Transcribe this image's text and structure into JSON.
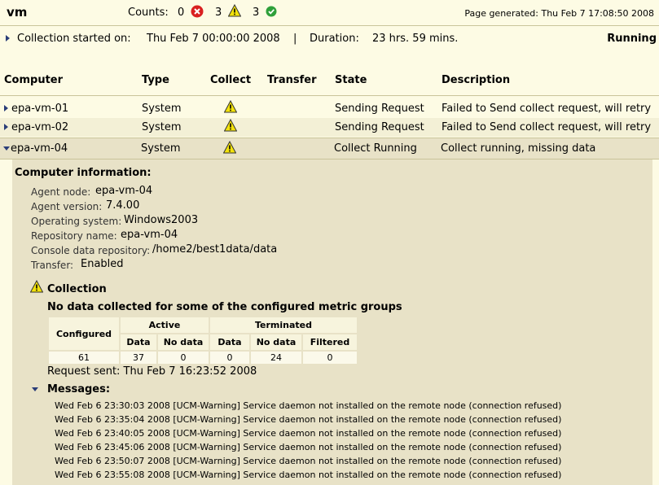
{
  "header": {
    "title": "vm",
    "counts_label": "Counts:",
    "error_count": "0",
    "warning_count": "3",
    "ok_count": "3",
    "page_generated": "Page generated: Thu Feb 7 17:08:50 2008"
  },
  "collection": {
    "started_label": "Collection started on:",
    "started_value": "Thu Feb 7 00:00:00 2008",
    "divider": "|",
    "duration_label": "Duration:",
    "duration_value": "23 hrs. 59 mins.",
    "status": "Running"
  },
  "columns": [
    "Computer",
    "Type",
    "Collect",
    "Transfer",
    "State",
    "Description"
  ],
  "rows": [
    {
      "computer": "epa-vm-01",
      "type": "System",
      "state": "Sending Request",
      "description": "Failed to Send collect request, will retry"
    },
    {
      "computer": "epa-vm-02",
      "type": "System",
      "state": "Sending Request",
      "description": "Failed to Send collect request, will retry"
    },
    {
      "computer": "epa-vm-04",
      "type": "System",
      "state": "Collect Running",
      "description": "Collect running, missing data"
    }
  ],
  "computer_info": {
    "heading": "Computer information:",
    "agent_node_label": "Agent node:",
    "agent_node": "epa-vm-04",
    "agent_version_label": "Agent version:",
    "agent_version": "7.4.00",
    "os_label": "Operating system:",
    "os": "Windows2003",
    "repo_label": "Repository name:",
    "repo": "epa-vm-04",
    "console_label": "Console data repository:",
    "console": "/home2/best1data/data",
    "transfer_label": "Transfer:",
    "transfer": "Enabled"
  },
  "collection_section": {
    "heading": "Collection",
    "note": "No data collected for some of the configured metric groups",
    "table": {
      "configured_label": "Configured",
      "active_label": "Active",
      "terminated_label": "Terminated",
      "data_label": "Data",
      "nodata_label": "No data",
      "filtered_label": "Filtered",
      "configured": "61",
      "active_data": "37",
      "active_nodata": "0",
      "term_data": "0",
      "term_nodata": "24",
      "term_filtered": "0"
    },
    "request_sent": "Request sent: Thu Feb 7 16:23:52 2008"
  },
  "messages": {
    "heading": "Messages:",
    "items": [
      "Wed Feb 6 23:30:03 2008 [UCM-Warning] Service daemon not installed on the remote node (connection refused)",
      "Wed Feb 6 23:35:04 2008 [UCM-Warning] Service daemon not installed on the remote node (connection refused)",
      "Wed Feb 6 23:40:05 2008 [UCM-Warning] Service daemon not installed on the remote node (connection refused)",
      "Wed Feb 6 23:45:06 2008 [UCM-Warning] Service daemon not installed on the remote node (connection refused)",
      "Wed Feb 6 23:50:07 2008 [UCM-Warning] Service daemon not installed on the remote node (connection refused)",
      "Wed Feb 6 23:55:08 2008 [UCM-Warning] Service daemon not installed on the remote node (connection refused)"
    ]
  },
  "colors": {
    "background": "#fdfbe4",
    "detail_bg": "#e8e2c7",
    "row_alt": "#f3f0d6",
    "error": "#d92020",
    "warning": "#f2e20a",
    "ok": "#2fa03a"
  },
  "icons": [
    "error-icon",
    "warning-icon",
    "ok-icon",
    "expand-arrow-icon",
    "collapse-arrow-icon"
  ]
}
